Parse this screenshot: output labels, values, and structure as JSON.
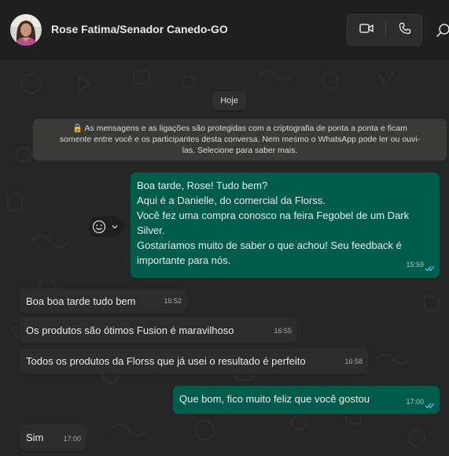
{
  "header": {
    "contact_name": "Rose Fatima/Senador Canedo-GO",
    "icons": [
      "avatar",
      "video-call-icon",
      "phone-icon",
      "search-icon"
    ]
  },
  "chat": {
    "date_chip": "Hoje",
    "encryption_notice": "🔒 As mensagens e as ligações são protegidas com a criptografia de ponta a ponta e ficam\nsomente entre você e os participantes desta conversa. Nem mesmo o WhatsApp pode ler ou ouvi-\nlas. Selecione para saber mais.",
    "messages": [
      {
        "direction": "outgoing",
        "text": "Boa tarde, Rose! Tudo bem?\nAqui é a Danielle, do comercial da Florss.\nVocê fez uma compra conosco na feira Fegobel de um Dark\nSilver.\nGostaríamos muito de saber o que achou! Seu feedback é\nimportante para nós.",
        "time": "15:59",
        "status": "read"
      },
      {
        "direction": "incoming",
        "text": "Boa boa tarde tudo bem",
        "time": "16:52"
      },
      {
        "direction": "incoming",
        "text": "Os produtos são ótimos   Fusion é maravilhoso",
        "time": "16:55"
      },
      {
        "direction": "incoming",
        "text": "Todos os produtos da Florss que já usei o resultado é perfeito",
        "time": "16:58"
      },
      {
        "direction": "outgoing",
        "text": "Que bom, fico muito feliz que você gostou",
        "time": "17:00",
        "status": "read"
      },
      {
        "direction": "incoming",
        "text": "Sim",
        "time": "17:00"
      }
    ],
    "reaction_button_icons": [
      "emoji-icon",
      "chevron-down-icon"
    ]
  },
  "colors": {
    "header_bg": "#202020",
    "chat_bg": "#262626",
    "outgoing_bubble": "#005c4b",
    "incoming_bubble": "#2c2c2c",
    "read_ticks": "#53bdeb"
  }
}
